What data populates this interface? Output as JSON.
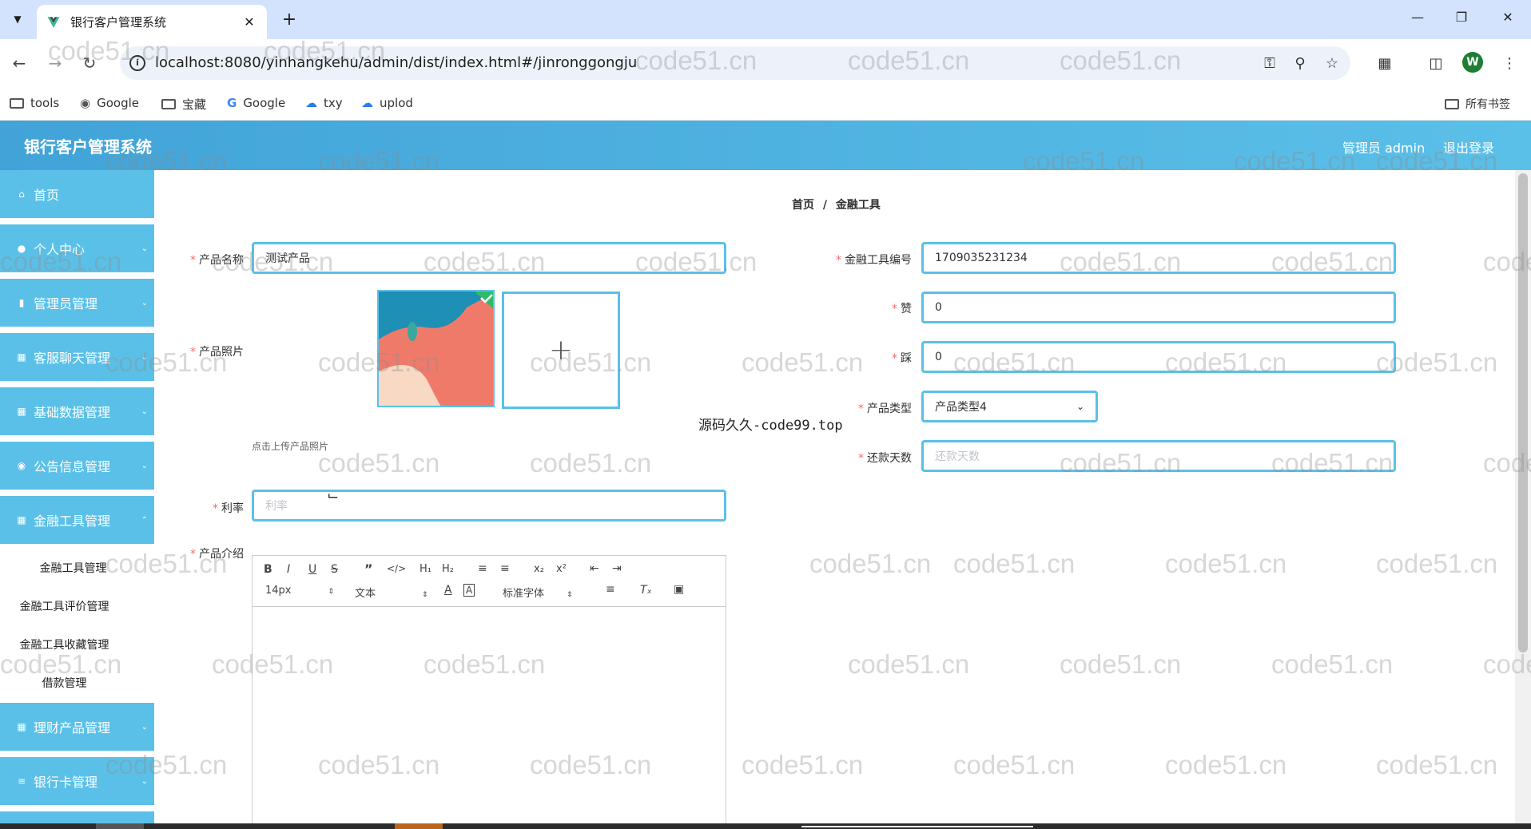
{
  "browser": {
    "tab_title": "银行客户管理系统",
    "url": "localhost:8080/yinhangkehu/admin/dist/index.html#/jinronggongju",
    "bookmarks": [
      "tools",
      "Google",
      "宝藏",
      "Google",
      "txy",
      "uplod"
    ],
    "all_bookmarks": "所有书签",
    "profile_initial": "W"
  },
  "header": {
    "app_title": "银行客户管理系统",
    "user": "管理员 admin",
    "logout": "退出登录",
    "color": "#5bc0e8"
  },
  "sidebar": {
    "items": [
      {
        "label": "首页",
        "icon": "home-icon"
      },
      {
        "label": "个人中心",
        "icon": "user-icon"
      },
      {
        "label": "管理员管理",
        "icon": "bar-chart-icon"
      },
      {
        "label": "客服聊天管理",
        "icon": "grid-icon"
      },
      {
        "label": "基础数据管理",
        "icon": "grid-icon"
      },
      {
        "label": "公告信息管理",
        "icon": "chat-icon"
      },
      {
        "label": "金融工具管理",
        "icon": "grid-icon"
      },
      {
        "label": "理财产品管理",
        "icon": "grid-icon"
      },
      {
        "label": "银行卡管理",
        "icon": "list-icon"
      }
    ],
    "sub_items": [
      "金融工具管理",
      "金融工具评价管理",
      "金融工具收藏管理",
      "借款管理"
    ]
  },
  "breadcrumb": {
    "home": "首页",
    "sep": "/",
    "current": "金融工具"
  },
  "form": {
    "product_name_label": "产品名称",
    "product_name_value": "测试产品",
    "product_photo_label": "产品照片",
    "photo_hint": "点击上传产品照片",
    "rate_label": "利率",
    "rate_placeholder": "利率",
    "intro_label": "产品介绍",
    "code_label": "金融工具编号",
    "code_value": "1709035231234",
    "zan_label": "赞",
    "zan_value": "0",
    "cai_label": "踩",
    "cai_value": "0",
    "type_label": "产品类型",
    "type_value": "产品类型4",
    "days_label": "还款天数",
    "days_placeholder": "还款天数",
    "required_mark": "*"
  },
  "editor": {
    "font_size": "14px",
    "text_type": "文本",
    "font_family": "标准字体"
  },
  "overlay_text": "源码久久-code99.top",
  "watermark": "code51.cn"
}
